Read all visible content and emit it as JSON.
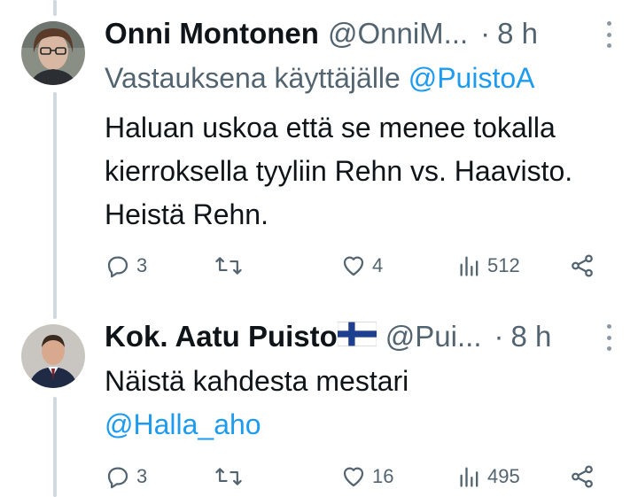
{
  "tweets": [
    {
      "author_name": "Onni Montonen",
      "handle": "@OnniM...",
      "separator": "·",
      "time": "8 h",
      "replying_prefix": "Vastauksena käyttäjälle",
      "replying_handle": "@PuistoA",
      "text": "Haluan uskoa että se menee tokalla kierroksella tyyliin Rehn vs. Haavisto. Heistä Rehn.",
      "stats": {
        "replies": "3",
        "retweets": "",
        "likes": "4",
        "views": "512"
      }
    },
    {
      "author_name": "Kok. Aatu Puisto",
      "author_flag": "finland-flag",
      "handle": "@Pui...",
      "separator": "·",
      "time": "8 h",
      "text": "Näistä kahdesta mestari",
      "mention": "@Halla_aho",
      "stats": {
        "replies": "3",
        "retweets": "",
        "likes": "16",
        "views": "495"
      }
    }
  ],
  "icons": [
    "reply-icon",
    "retweet-icon",
    "like-icon",
    "views-icon",
    "share-icon",
    "more-icon"
  ],
  "colors": {
    "text": "#0f1419",
    "secondary": "#536471",
    "link": "#1d9bf0",
    "thread_line": "#cfd9de"
  }
}
